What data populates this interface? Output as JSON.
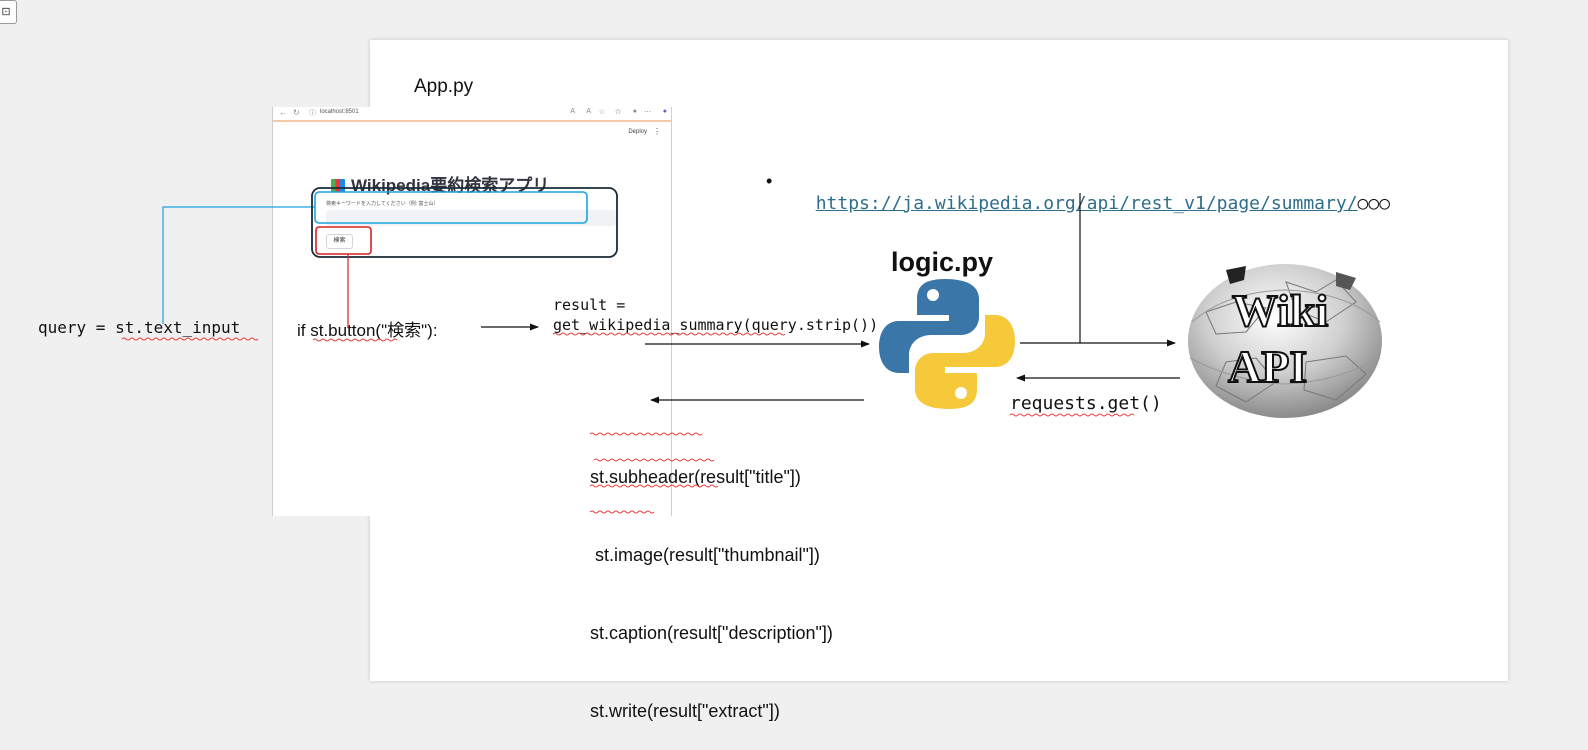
{
  "slide": {
    "app_label": "App.py",
    "logic_label": "logic.py"
  },
  "browser": {
    "url": "localhost:8501",
    "deploy_label": "Deploy",
    "app_title": "Wikipedia要約検索アプリ",
    "input_label": "検索キーワードを入力してください（例: 富士山）",
    "search_button_label": "検索"
  },
  "code": {
    "query_line": "query = st.text_input",
    "button_line": "if st.button(\"検索\"):",
    "result_line1": "result =",
    "result_line2": "get_wikipedia_summary(query.strip())",
    "requests_line": "requests.get()",
    "display_lines": [
      "st.subheader(result[\"title\"])",
      " st.image(result[\"thumbnail\"])",
      "st.caption(result[\"description\"])",
      "st.write(result[\"extract\"])"
    ]
  },
  "api": {
    "url": "https://ja.wikipedia.org/api/rest_v1/page/summary/",
    "url_suffix": "○○○",
    "logo_line1": "Wiki",
    "logo_line2": "API"
  },
  "colors": {
    "text_input_highlight": "#1aa3e0",
    "button_highlight": "#d62020",
    "link": "#2e6e8a",
    "python_blue": "#3a76a8",
    "python_yellow": "#f5c93a"
  },
  "icons": {
    "corner": "toggle-icon",
    "python": "python-logo",
    "wikipedia": "wikipedia-globe-logo"
  }
}
